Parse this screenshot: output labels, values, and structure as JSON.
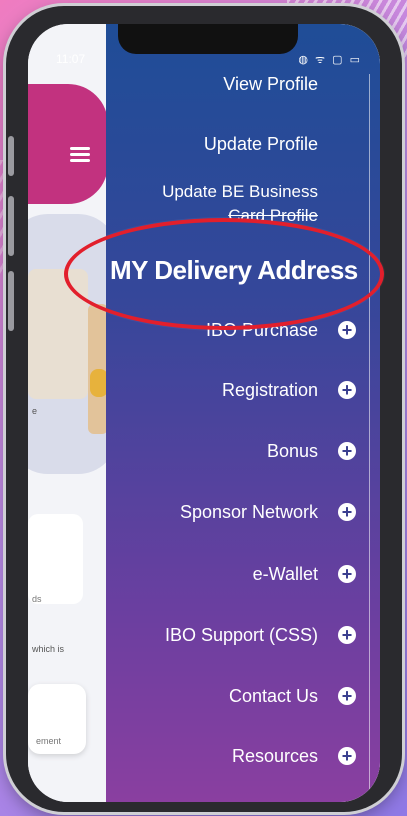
{
  "status": {
    "time": "11:07",
    "icons": "◍ ᯤ ▢ ▭"
  },
  "drawer": {
    "items": [
      {
        "label": "View Profile",
        "plus": false
      },
      {
        "label": "Update Profile",
        "plus": false
      },
      {
        "label": "Update BE Business",
        "plus": false
      },
      {
        "label": "Card Profile",
        "plus": false
      },
      {
        "label": "IBO Purchase",
        "plus": true
      },
      {
        "label": "Registration",
        "plus": true
      },
      {
        "label": "Bonus",
        "plus": true
      },
      {
        "label": "Sponsor Network",
        "plus": true
      },
      {
        "label": "e-Wallet",
        "plus": true
      },
      {
        "label": "IBO Support (CSS)",
        "plus": true
      },
      {
        "label": "Contact Us",
        "plus": true
      },
      {
        "label": "Resources",
        "plus": true
      }
    ],
    "highlight_label": "MY Delivery Address"
  },
  "background_app": {
    "snippet1": "e",
    "snippet2": "ds",
    "snippet3": "which is",
    "snippet4": "ement"
  },
  "colors": {
    "drawer_top": "#1f4d97",
    "drawer_bottom": "#8a3fa0",
    "highlight": "#e21f2c",
    "hero": "#c2327f"
  }
}
